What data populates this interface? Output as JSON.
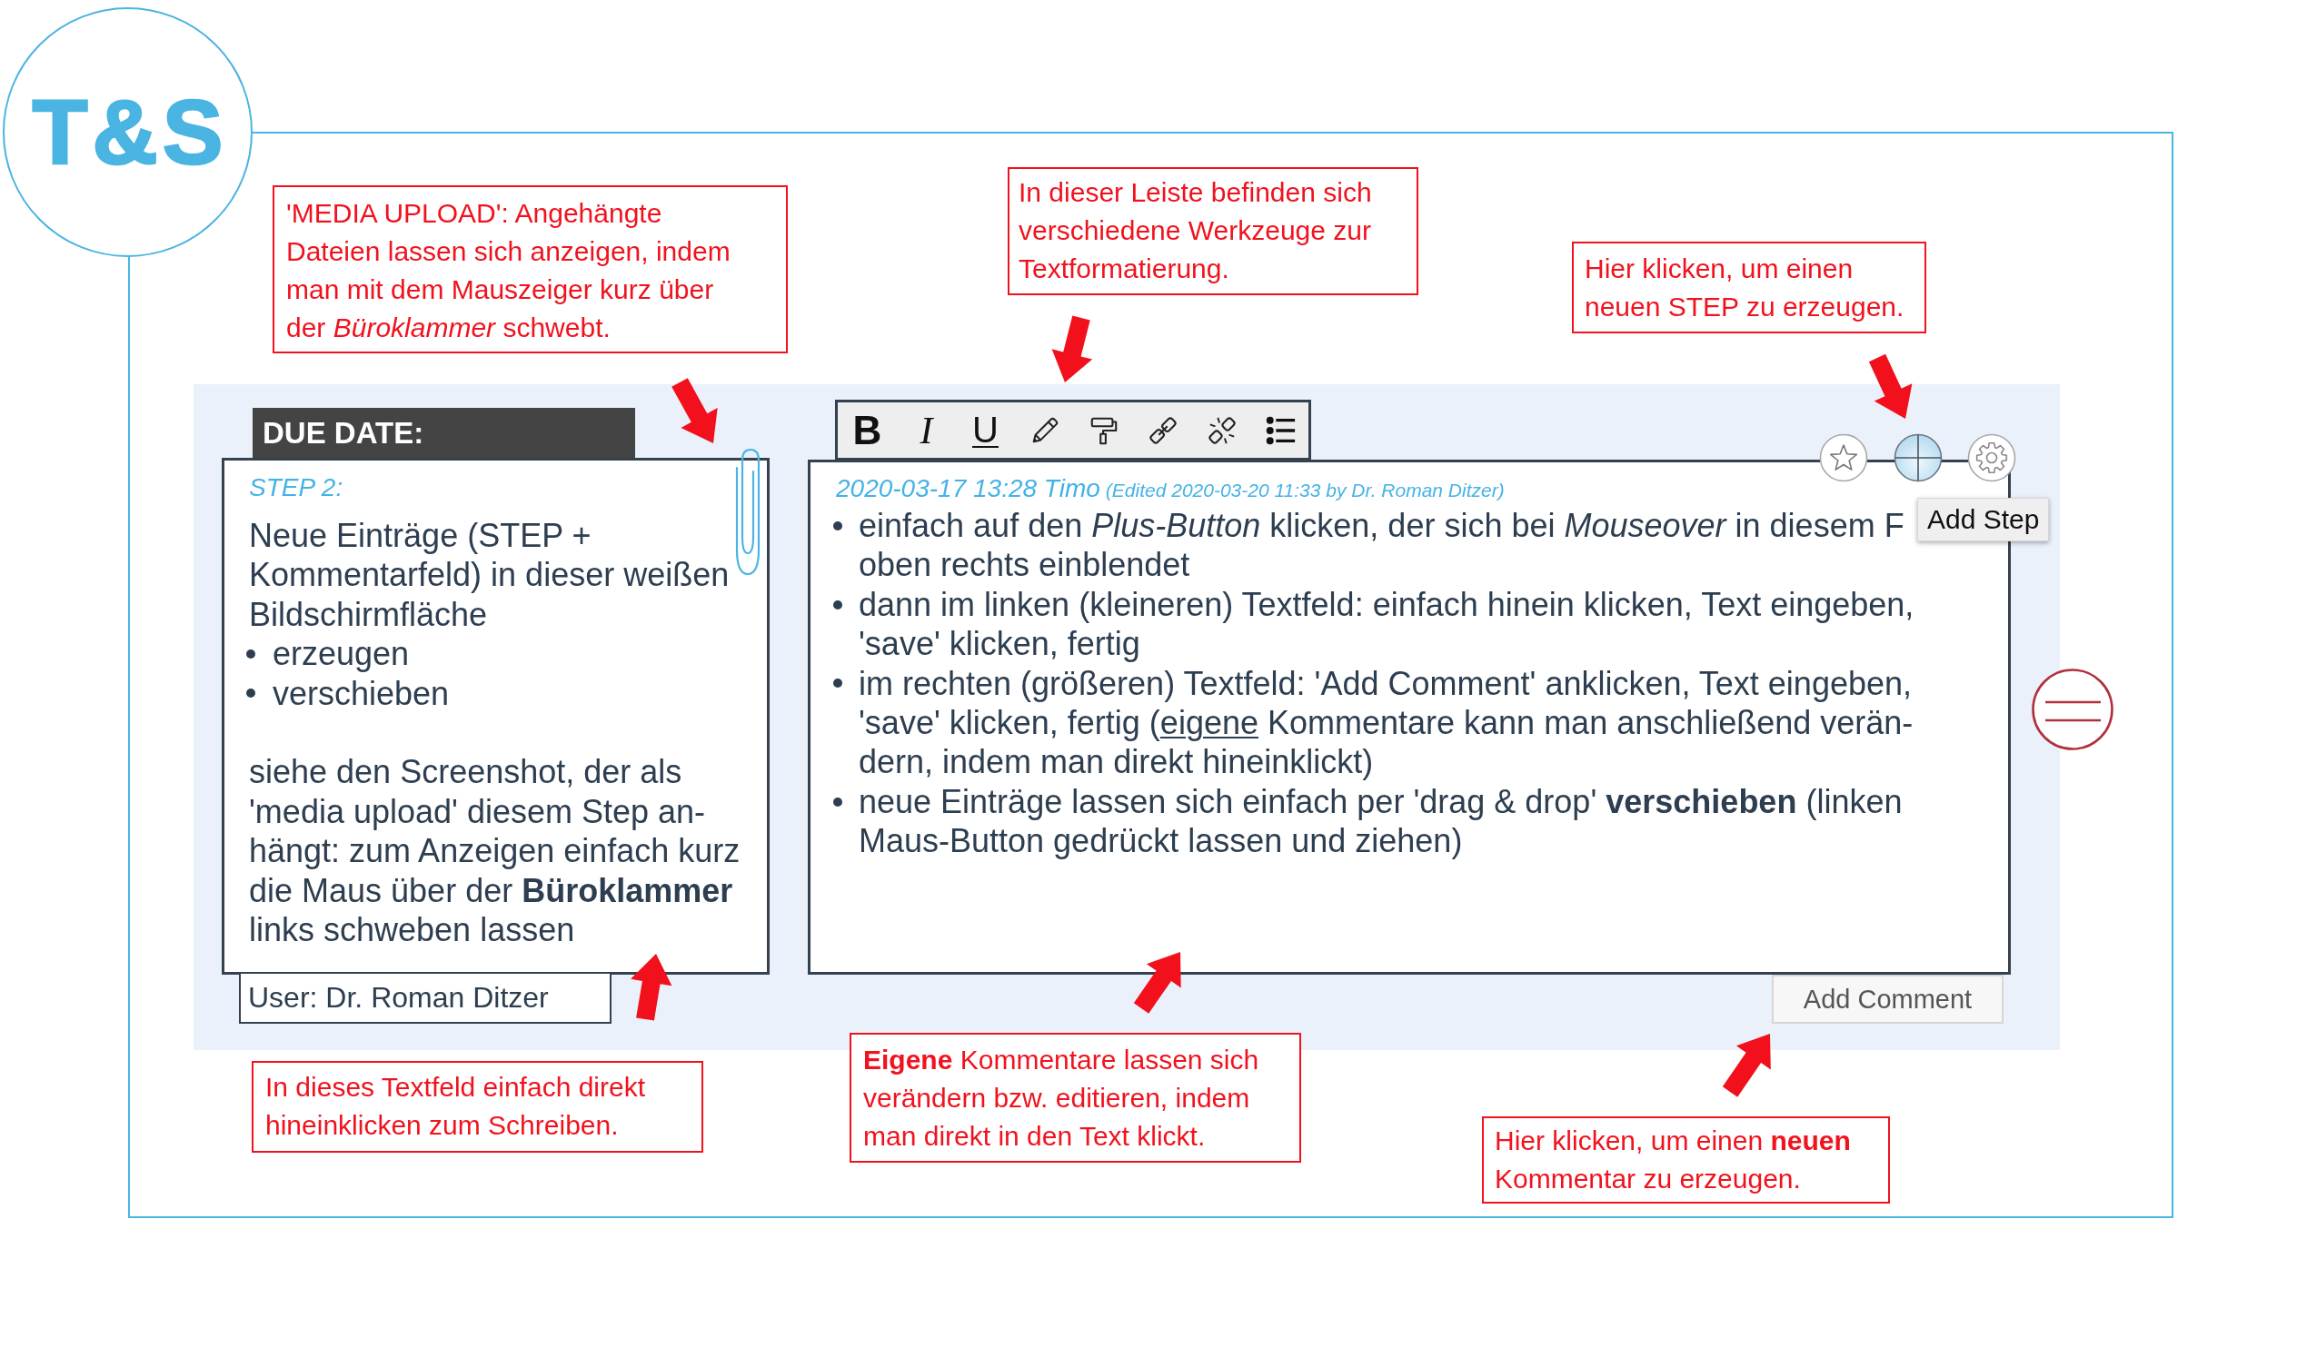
{
  "logo": {
    "text": "T&S"
  },
  "callouts": [
    {
      "text": "'MEDIA UPLOAD': Angehängte Dateien lassen sich anzeigen, indem man mit dem Mauszeiger kurz über der *Büroklammer* schwebt."
    },
    {
      "text": "In dieser Leiste befinden sich verschiedene Werkzeuge zur Textformatierung."
    },
    {
      "text": "Hier klicken, um einen neuen STEP zu erzeugen."
    },
    {
      "text": "In dieses Textfeld einfach direkt hineinklicken zum Schreiben."
    },
    {
      "text": "**Eigene** Kommentare lassen sich verändern bzw. editieren, indem man direkt in den Text klickt."
    },
    {
      "text": "Hier klicken, um einen **neuen** Kommentar zu erzeugen."
    }
  ],
  "step": {
    "due_date": "DUE DATE:",
    "title": "STEP 2:",
    "intro": "Neue Einträge (STEP + Kommentarfeld) in dieser weißen Bildschirmfläche",
    "bullets": [
      "erzeugen",
      "verschieben"
    ],
    "note": "siehe den Screenshot, der als 'media upload' diesem Step an-hängt: zum Anzeigen einfach kurz die Maus über der **Büroklammer** links schweben lassen",
    "user": "User: Dr. Roman Ditzer"
  },
  "editor": {
    "toolbar": [
      {
        "kind": "bold",
        "label": "B"
      },
      {
        "kind": "italic",
        "label": "I"
      },
      {
        "kind": "underline",
        "label": "U"
      }
    ],
    "comment": {
      "author_line": "2020-03-17 13:28 Timo",
      "edited_note": "(Edited 2020-03-20 11:33 by Dr. Roman Ditzer)",
      "bullets": [
        {
          "parts": [
            {
              "text": "einfach auf den *Plus-Button* klicken, der sich bei *Mouseover* in diesem F oben rechts einblendet",
              "underline": false
            }
          ]
        },
        {
          "parts": [
            {
              "text": "dann im linken (kleineren) Textfeld: einfach hinein klicken, Text eingeben, 'save' klicken, fertig",
              "underline": false
            }
          ]
        },
        {
          "parts": [
            {
              "text": "im rechten (größeren) Textfeld: 'Add Comment' anklicken, Text eingeben, 'save' klicken, fertig (",
              "underline": false
            },
            {
              "text": "eigene",
              "underline": true
            },
            {
              "text": " Kommentare kann man anschließend verän-dern, indem man direkt hineinklickt)",
              "underline": false
            }
          ]
        },
        {
          "parts": [
            {
              "text": "neue Einträge lassen sich einfach per 'drag & drop' **verschieben** (linken Maus-Button gedrückt lassen und ziehen)",
              "underline": false
            }
          ]
        }
      ]
    },
    "tooltip": "Add Step",
    "add_comment": "Add Comment"
  }
}
